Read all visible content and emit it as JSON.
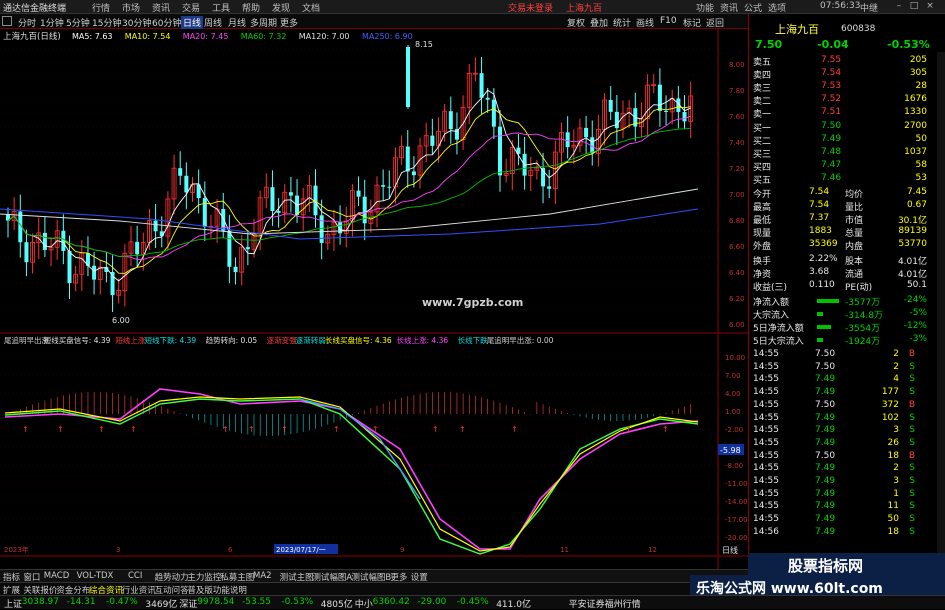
{
  "titlebar": {
    "app": "通达信金融终端",
    "menus": [
      "行情",
      "市场",
      "资讯",
      "交易",
      "工具",
      "帮助",
      "发现",
      "文档"
    ],
    "login": "交易未登录",
    "stock": "上海九百",
    "right": [
      "功能",
      "资讯",
      "公式",
      "选项"
    ],
    "time": "07:56:33",
    "mode": "中继"
  },
  "menubar": {
    "periods": [
      "分时",
      "1分钟",
      "5分钟",
      "15分钟",
      "30分钟",
      "60分钟",
      "日线",
      "周线",
      "月线",
      "多周期",
      "更多"
    ],
    "selected": "日线",
    "right": [
      "复权",
      "叠加",
      "统计",
      "画线",
      "F10",
      "标记",
      "返回"
    ]
  },
  "chart": {
    "title": "上海九百(日线)",
    "ma_labels": [
      {
        "t": "MA5: 7.63",
        "c": "#ffffff"
      },
      {
        "t": "MA10: 7.54",
        "c": "#ffff00"
      },
      {
        "t": "MA20: 7.45",
        "c": "#ff40ff"
      },
      {
        "t": "MA60: 7.32",
        "c": "#00d000"
      },
      {
        "t": "MA120: 7.00",
        "c": "#e0e0e0"
      },
      {
        "t": "MA250: 6.90",
        "c": "#4060ff"
      }
    ],
    "price_ticks": [
      "8.00",
      "7.80",
      "7.60",
      "7.40",
      "7.20",
      "7.00",
      "6.80",
      "6.60",
      "6.40",
      "6.20",
      "6.00"
    ],
    "high_label": "8.15",
    "low_label": "6.00",
    "watermark": "www.7gpzb.com",
    "ind_header": [
      {
        "t": "尾追明早出涨",
        "c": "#d0d0d0"
      },
      {
        "t": "短线买盘信号: 4.39",
        "c": "#e0e0e0"
      },
      {
        "t": "短线上涨",
        "c": "#ff3c3c"
      },
      {
        "t": "短线下跌: 4.39",
        "c": "#00e0e0"
      },
      {
        "t": "趋势转向: 0.05",
        "c": "#e0e0e0"
      },
      {
        "t": "逐渐变强",
        "c": "#ff3c3c"
      },
      {
        "t": "逐渐转弱",
        "c": "#00e0e0"
      },
      {
        "t": "长线买盘信号: 4.36",
        "c": "#ffff00"
      },
      {
        "t": "长线上涨: 4.36",
        "c": "#ff40ff"
      },
      {
        "t": "长线下跌",
        "c": "#00e0e0"
      },
      {
        "t": "尾追明早出涨: 0.00",
        "c": "#d0d0d0"
      }
    ],
    "ind_ticks": [
      "10.00",
      "7.00",
      "4.00",
      "1.00",
      "-2.00",
      "-5.00",
      "-8.00",
      "-11.00",
      "-14.00",
      "-17.00",
      "-20.00"
    ],
    "ind_value": "-5.98",
    "x_labels": [
      "2023年",
      "3",
      "6",
      "2023/07/17/一",
      "9",
      "11",
      "12"
    ],
    "day_label": "日线",
    "x_axis_ticks": []
  },
  "bottom_tabs": [
    "指标",
    "窗口",
    "MACD",
    "VOL-TDX",
    "CCI",
    "趋势动力",
    "主力监控",
    "私募主图",
    "MA2",
    "测试主图",
    "测试幅图A",
    "测试幅图B",
    "更多",
    "设置"
  ],
  "bottom_tabs2": [
    "扩展",
    "关联报价",
    "资金分布",
    "综合资讯",
    "行业资讯",
    "互动问答",
    "普及版功能说明"
  ],
  "sidebar": {
    "name": "上海九百",
    "code": "600838",
    "price": "7.50",
    "change": "-0.04",
    "pct": "-0.53%",
    "asks": [
      {
        "l": "卖五",
        "p": "7.55",
        "v": "205"
      },
      {
        "l": "卖四",
        "p": "7.54",
        "v": "305"
      },
      {
        "l": "卖三",
        "p": "7.53",
        "v": "28"
      },
      {
        "l": "卖二",
        "p": "7.52",
        "v": "1676"
      },
      {
        "l": "卖一",
        "p": "7.51",
        "v": "1330"
      }
    ],
    "bids": [
      {
        "l": "买一",
        "p": "7.50",
        "v": "2700"
      },
      {
        "l": "买二",
        "p": "7.49",
        "v": "50"
      },
      {
        "l": "买三",
        "p": "7.48",
        "v": "1037"
      },
      {
        "l": "买四",
        "p": "7.47",
        "v": "58"
      },
      {
        "l": "买五",
        "p": "7.46",
        "v": "53"
      }
    ],
    "stats": [
      {
        "a": "今开",
        "b": "7.54",
        "c": "均价",
        "d": "7.45"
      },
      {
        "a": "最高",
        "b": "7.54",
        "c": "量比",
        "d": "0.67"
      },
      {
        "a": "最低",
        "b": "7.37",
        "c": "市值",
        "d": "30.1亿"
      },
      {
        "a": "现量",
        "b": "1883",
        "c": "总量",
        "d": "89139"
      },
      {
        "a": "外盘",
        "b": "35369",
        "c": "内盘",
        "d": "53770"
      }
    ],
    "stats2": [
      {
        "a": "换手",
        "b": "2.22%",
        "c": "股本",
        "d": "4.01亿"
      },
      {
        "a": "净资",
        "b": "3.68",
        "c": "流通",
        "d": "4.01亿"
      },
      {
        "a": "收益(三)",
        "b": "0.110",
        "c": "PE(动)",
        "d": "50.1"
      }
    ],
    "flows": [
      {
        "l": "净流入额",
        "v": "-3577万",
        "p": "-24%"
      },
      {
        "l": "大宗流入",
        "v": "-314.8万",
        "p": "-5%"
      },
      {
        "l": "5日净流入额",
        "v": "-3554万",
        "p": "-12%"
      },
      {
        "l": "5日大宗流入",
        "v": "-1924万",
        "p": "-3%"
      }
    ],
    "ticks": [
      {
        "t": "14:55",
        "p": "7.50",
        "v": "2",
        "s": "B"
      },
      {
        "t": "14:55",
        "p": "7.50",
        "v": "2",
        "s": "S"
      },
      {
        "t": "14:55",
        "p": "7.49",
        "v": "4",
        "s": "S"
      },
      {
        "t": "14:55",
        "p": "7.49",
        "v": "177",
        "s": "S"
      },
      {
        "t": "14:55",
        "p": "7.50",
        "v": "372",
        "s": "B"
      },
      {
        "t": "14:55",
        "p": "7.49",
        "v": "102",
        "s": "S"
      },
      {
        "t": "14:55",
        "p": "7.49",
        "v": "3",
        "s": "S"
      },
      {
        "t": "14:55",
        "p": "7.49",
        "v": "26",
        "s": "S"
      },
      {
        "t": "14:55",
        "p": "7.50",
        "v": "18",
        "s": "B"
      },
      {
        "t": "14:55",
        "p": "7.49",
        "v": "2",
        "s": "S"
      },
      {
        "t": "14:55",
        "p": "7.49",
        "v": "3",
        "s": "S"
      },
      {
        "t": "14:55",
        "p": "7.49",
        "v": "1",
        "s": "S"
      },
      {
        "t": "14:55",
        "p": "7.49",
        "v": "11",
        "s": "S"
      },
      {
        "t": "14:55",
        "p": "7.49",
        "v": "50",
        "s": "S"
      },
      {
        "t": "14:56",
        "p": "7.49",
        "v": "18",
        "s": "S"
      }
    ]
  },
  "brand": {
    "line1": "股票指标网",
    "line2": "乐淘公式网 www.60lt.com"
  },
  "status": [
    {
      "t": "上证",
      "c": "#e0e0e0"
    },
    {
      "t": "3038.97",
      "c": "#00d000"
    },
    {
      "t": "-14.31",
      "c": "#00d000"
    },
    {
      "t": "-0.47%",
      "c": "#00d000"
    },
    {
      "t": "3469亿",
      "c": "#e0e0e0"
    },
    {
      "t": "深证",
      "c": "#e0e0e0"
    },
    {
      "t": "9978.54",
      "c": "#00d000"
    },
    {
      "t": "-53.55",
      "c": "#00d000"
    },
    {
      "t": "-0.53%",
      "c": "#00d000"
    },
    {
      "t": "4805亿",
      "c": "#e0e0e0"
    },
    {
      "t": "中小",
      "c": "#e0e0e0"
    },
    {
      "t": "6360.42",
      "c": "#00d000"
    },
    {
      "t": "-29.00",
      "c": "#00d000"
    },
    {
      "t": "-0.45%",
      "c": "#00d000"
    },
    {
      "t": "411.0亿",
      "c": "#e0e0e0"
    },
    {
      "t": "平安证券福州行情",
      "c": "#e0e0e0"
    }
  ]
}
